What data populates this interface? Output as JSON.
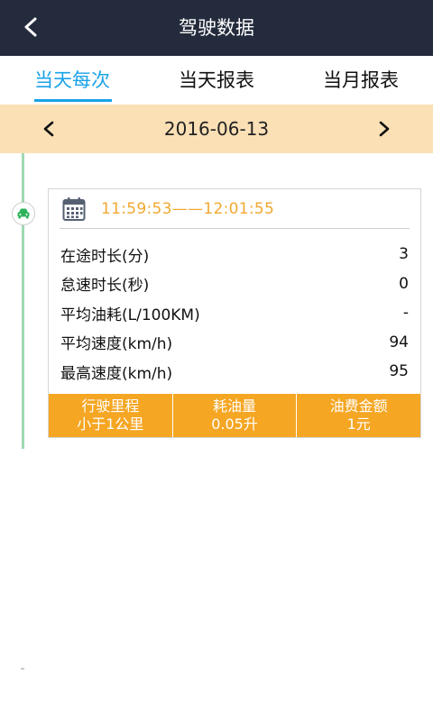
{
  "header": {
    "title": "驾驶数据",
    "back_icon": "chevron-left-icon"
  },
  "tabs": [
    {
      "label": "当天每次",
      "active": true
    },
    {
      "label": "当天报表",
      "active": false
    },
    {
      "label": "当月报表",
      "active": false
    }
  ],
  "date_bar": {
    "date": "2016-06-13",
    "prev_icon": "chevron-left-icon",
    "next_icon": "chevron-right-icon"
  },
  "trip": {
    "time_range": "11:59:53——12:01:55",
    "stats": [
      {
        "label": "在途时长(分)",
        "value": "3"
      },
      {
        "label": "怠速时长(秒)",
        "value": "0"
      },
      {
        "label": "平均油耗(L/100KM)",
        "value": "-"
      },
      {
        "label": "平均速度(km/h)",
        "value": "94"
      },
      {
        "label": "最高速度(km/h)",
        "value": "95"
      }
    ],
    "summary": [
      {
        "label": "行驶里程",
        "value": "小于1公里"
      },
      {
        "label": "耗油量",
        "value": "0.05升"
      },
      {
        "label": "油费金额",
        "value": "1元"
      }
    ]
  },
  "colors": {
    "header_bg": "#232b3c",
    "accent_blue": "#1aa3e8",
    "date_bar_bg": "#fbe0b5",
    "time_orange": "#f0a830",
    "summary_orange": "#f5a623",
    "timeline_green": "#9ed9b0"
  }
}
